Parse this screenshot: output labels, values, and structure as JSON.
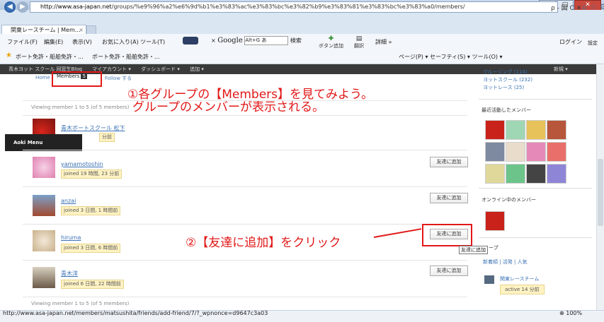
{
  "browser": {
    "address": "http://www.asa-japan.net/groups/%e9%96%a2%e6%9d%b1%e3%83%ac%e3%83%bc%e3%82%b9%e3%83%81%e3%83%bc%e3%83%a0/members/",
    "address_host": "http://www.asa-japan.net",
    "address_path": "/groups/%e9%96%a2%e6%9d%b1%e3%83%ac%e3%83%bc%e3%82%b9%e3%83%81%e3%83%bc%e3%83%a0/members/",
    "address_tools": "ρ - 図 C ✕",
    "tab_title": "関東レースチーム | Mem...",
    "tab_close": "×",
    "menu": [
      "ファイル(F)",
      "編集(E)",
      "表示(V)",
      "お気に入り(A)",
      "ツール(T)"
    ],
    "toolbar_search_close": "×",
    "google_label": "Google",
    "google_box": "Alt+G あ",
    "search_btn": "検索",
    "btn_add": "ボタン追加",
    "btn_translate": "翻訳",
    "btn_detail": "詳細 »",
    "login": "ログイン",
    "settings": "設定",
    "favorites": [
      "ボート免許・船舶免許・...",
      "ボート免許・船舶免許・..."
    ],
    "cmdbar": "ページ(P) ▾  セーフティ(S) ▾  ツール(O) ▾",
    "status_url": "http://www.asa-japan.net/members/matsushita/friends/add-friend/7/?_wpnonce=d9647c3a03",
    "zoom": "100%"
  },
  "adminbar": {
    "items": [
      "青木ヨット スクール 同窓生Blog",
      "マイアカウント ▾",
      "ダッシュボード ▾",
      "追加 ▾"
    ],
    "right": "新規 ▾"
  },
  "subnav": {
    "home": "Home",
    "members": "Members",
    "members_count": "5",
    "follow": "Follow する"
  },
  "callouts": {
    "c1_line1": "①各グループの【Members】を見てみよう。",
    "c1_line2": "グループのメンバーが表示される。",
    "c2": "②【友達に追加】をクリック"
  },
  "viewing_top": "Viewing member 1 to 5 (of 5 members)",
  "viewing_bottom": "Viewing member 1 to 5 (of 5 members)",
  "aoki_menu": "Aoki Menu",
  "members": [
    {
      "name": "青木ボートスクール 松下",
      "time": "分前",
      "add": ""
    },
    {
      "name": "yamamotoshin",
      "time": "joined 19 時間, 23 分前",
      "add": "友達に追加"
    },
    {
      "name": "anzai",
      "time": "joined 3 日間, 1 時間前",
      "add": "友達に追加"
    },
    {
      "name": "hiruma",
      "time": "joined 3 日間, 6 時間前",
      "add": "友達に追加"
    },
    {
      "name": "青木洋",
      "time": "joined 6 日間, 22 時間前",
      "add": "友達に追加"
    }
  ],
  "tooltip": "友達に追加",
  "sidebar": {
    "groups_top": [
      "クルージング (114)",
      "ヨットスクール (232)",
      "ヨットレース (25)"
    ],
    "recent_title": "最近活動したメンバー",
    "online_title": "オンライン中のメンバー",
    "groups_title": "ープ",
    "groups_tabs": "新着順 | 活発 | 人気",
    "group_name": "関東レースチーム",
    "group_active": "active 14 分前"
  },
  "colors": {
    "callout_red": "#e21818",
    "link_blue": "#3b72b4"
  }
}
